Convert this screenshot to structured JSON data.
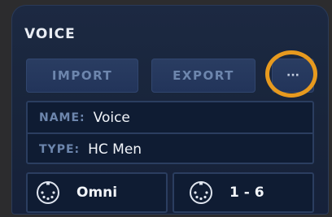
{
  "panel": {
    "title": "VOICE"
  },
  "buttons": {
    "import_label": "IMPORT",
    "export_label": "EXPORT",
    "more_label": "···"
  },
  "fields": {
    "name_label": "NAME:",
    "name_value": "Voice",
    "type_label": "TYPE:",
    "type_value": "HC Men"
  },
  "midi": {
    "input_value": "Omni",
    "channel_value": "1 - 6",
    "icon": "midi-port-icon"
  },
  "colors": {
    "panel_bg": "#1c2942",
    "button_bg": "#2a3d62",
    "field_bg": "#0f1c33",
    "label_color": "#6d86ad",
    "value_color": "#f2f5fa",
    "highlight": "#e79a1f"
  }
}
